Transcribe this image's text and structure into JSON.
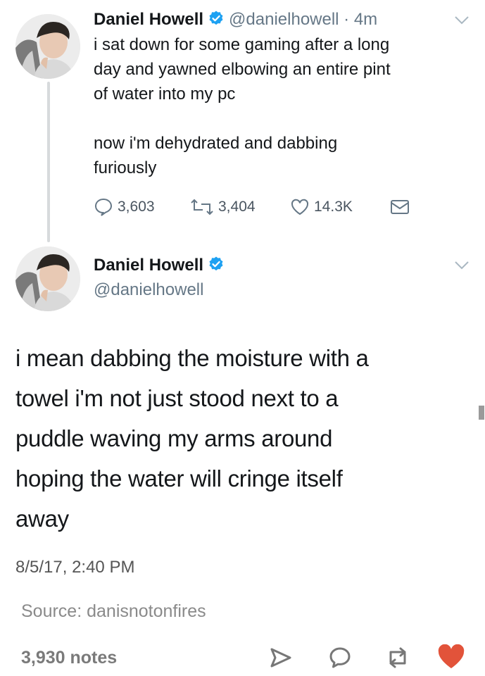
{
  "tweet1": {
    "author_name": "Daniel Howell",
    "handle_time": "@danielhowell · 4m",
    "text": "i sat down for some gaming after a long\nday and yawned elbowing an entire pint\nof water into my pc\n\nnow i'm dehydrated and dabbing\nfuriously",
    "replies": "3,603",
    "retweets": "3,404",
    "likes": "14.3K"
  },
  "tweet2": {
    "author_name": "Daniel Howell",
    "handle": "@danielhowell",
    "text": "i mean dabbing the moisture with a\ntowel i'm not just stood next to a\npuddle waving my arms around\nhoping the water will cringe itself\naway",
    "timestamp": "8/5/17, 2:40 PM"
  },
  "post_footer": {
    "source": "Source: danisnotonfires",
    "notes": "3,930 notes"
  },
  "icons": {
    "verified": "verified-badge-icon",
    "caret": "chevron-down-icon",
    "reply": "reply-icon",
    "retweet": "retweet-icon",
    "like": "heart-icon",
    "dm": "envelope-icon",
    "share": "share-icon",
    "comment": "comment-icon",
    "reblog": "reblog-icon",
    "heart_filled": "heart-filled-icon"
  },
  "colors": {
    "verified_blue": "#1da1f2",
    "like_red": "#e2533a",
    "text": "#14171a",
    "muted": "#657786"
  }
}
